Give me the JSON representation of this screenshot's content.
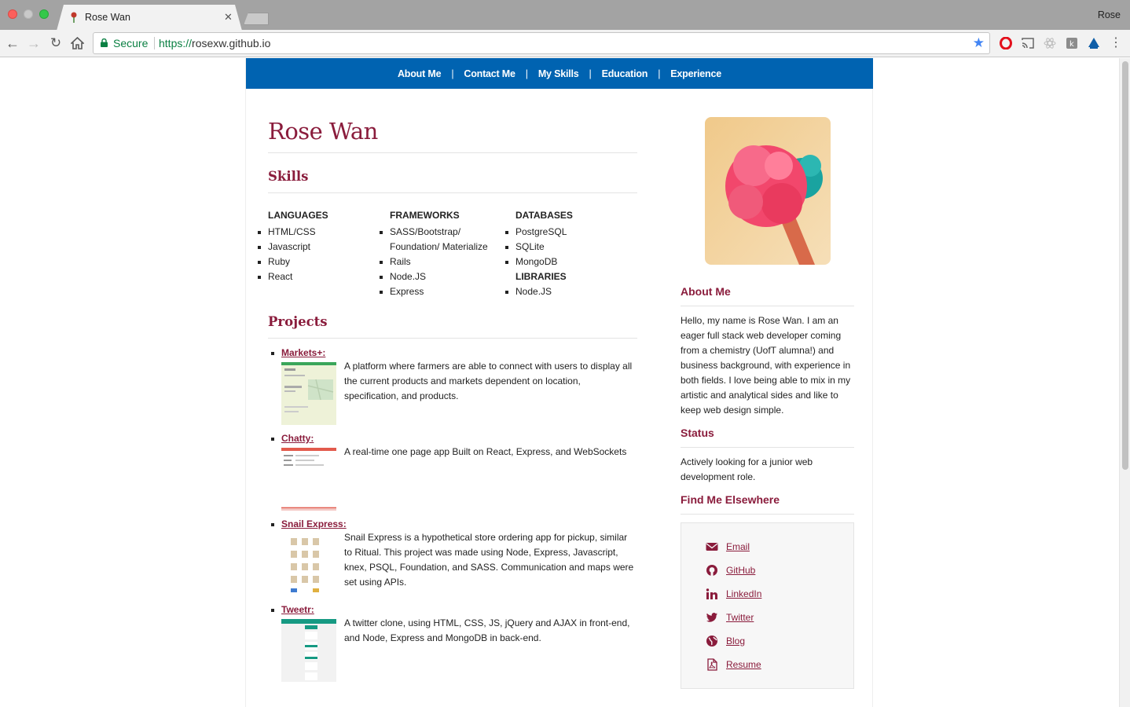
{
  "browser": {
    "tab_title": "Rose Wan",
    "profile_name": "Rose",
    "secure_label": "Secure",
    "url_scheme": "https://",
    "url_host": "rosexw.github.io"
  },
  "nav": {
    "items": [
      "About Me",
      "Contact Me",
      "My Skills",
      "Education",
      "Experience"
    ],
    "divider": "|"
  },
  "header": {
    "name": "Rose Wan"
  },
  "skills": {
    "heading": "Skills",
    "languages": {
      "title": "LANGUAGES",
      "items": [
        "HTML/CSS",
        "Javascript",
        "Ruby",
        "React"
      ]
    },
    "frameworks": {
      "title": "FRAMEWORKS",
      "items": [
        "SASS/Bootstrap/",
        "Foundation/ Materialize",
        "Rails",
        "Node.JS",
        "Express"
      ]
    },
    "databases": {
      "title": "DATABASES",
      "items": [
        "PostgreSQL",
        "SQLite",
        "MongoDB"
      ]
    },
    "libraries": {
      "title": "LIBRARIES",
      "items": [
        "Node.JS"
      ]
    }
  },
  "projects": {
    "heading": "Projects",
    "items": [
      {
        "title": "Markets+:",
        "desc": "A platform where farmers are able to connect with users to display all the current products and markets dependent on location, specification, and products."
      },
      {
        "title": "Chatty:",
        "desc": "A real-time one page app Built on React, Express, and WebSockets"
      },
      {
        "title": "Snail Express:",
        "desc": "Snail Express is a hypothetical store ordering app for pickup, similar to Ritual. This project was made using Node, Express, Javascript, knex, PSQL, Foundation, and SASS. Communication and maps were set using APIs."
      },
      {
        "title": "Tweetr:",
        "desc": "A twitter clone, using HTML, CSS, JS, jQuery and AJAX in front-end, and Node, Express and MongoDB in back-end."
      }
    ]
  },
  "sidebar": {
    "about_heading": "About Me",
    "about_text": "Hello, my name is Rose Wan. I am an eager full stack web developer coming from a chemistry (UofT alumna!) and business background, with experience in both fields. I love being able to mix in my artistic and analytical sides and like to keep web design simple.",
    "status_heading": "Status",
    "status_text": "Actively looking for a junior web development role.",
    "elsewhere_heading": "Find Me Elsewhere",
    "links": [
      {
        "label": "Email",
        "icon": "envelope-icon"
      },
      {
        "label": "GitHub",
        "icon": "github-icon"
      },
      {
        "label": "LinkedIn",
        "icon": "linkedin-icon"
      },
      {
        "label": "Twitter",
        "icon": "twitter-icon"
      },
      {
        "label": "Blog",
        "icon": "globe-icon"
      },
      {
        "label": "Resume",
        "icon": "pdf-icon"
      }
    ]
  },
  "colors": {
    "accent": "#8a1c3c",
    "nav_bg": "#0063b1",
    "secure": "#0b8043"
  }
}
